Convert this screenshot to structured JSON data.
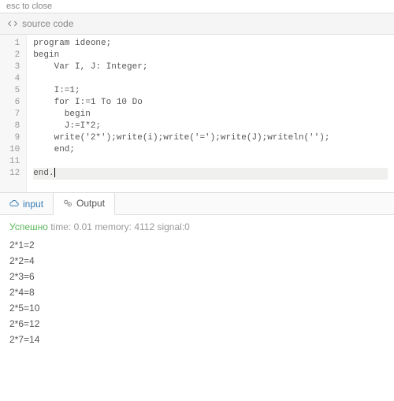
{
  "top_hint": "esc to close",
  "source_header": "source code",
  "code": {
    "lines": [
      "program ideone;",
      "begin",
      "    Var I, J: Integer;",
      "",
      "    I:=1;",
      "    for I:=1 To 10 Do",
      "      begin",
      "      J:=I*2;",
      "    write('2*');write(i);write('=');write(J);writeln('');",
      "    end;",
      "",
      "end."
    ],
    "active_line_index": 11
  },
  "tabs": {
    "input_label": "input",
    "output_label": "Output",
    "active": "output"
  },
  "status": {
    "success_label": "Успешно",
    "time_label": "time: 0.01",
    "memory_label": "memory: 4112",
    "signal_label": "signal:0"
  },
  "output_lines": [
    "2*1=2",
    "2*2=4",
    "2*3=6",
    "2*4=8",
    "2*5=10",
    "2*6=12",
    "2*7=14"
  ]
}
